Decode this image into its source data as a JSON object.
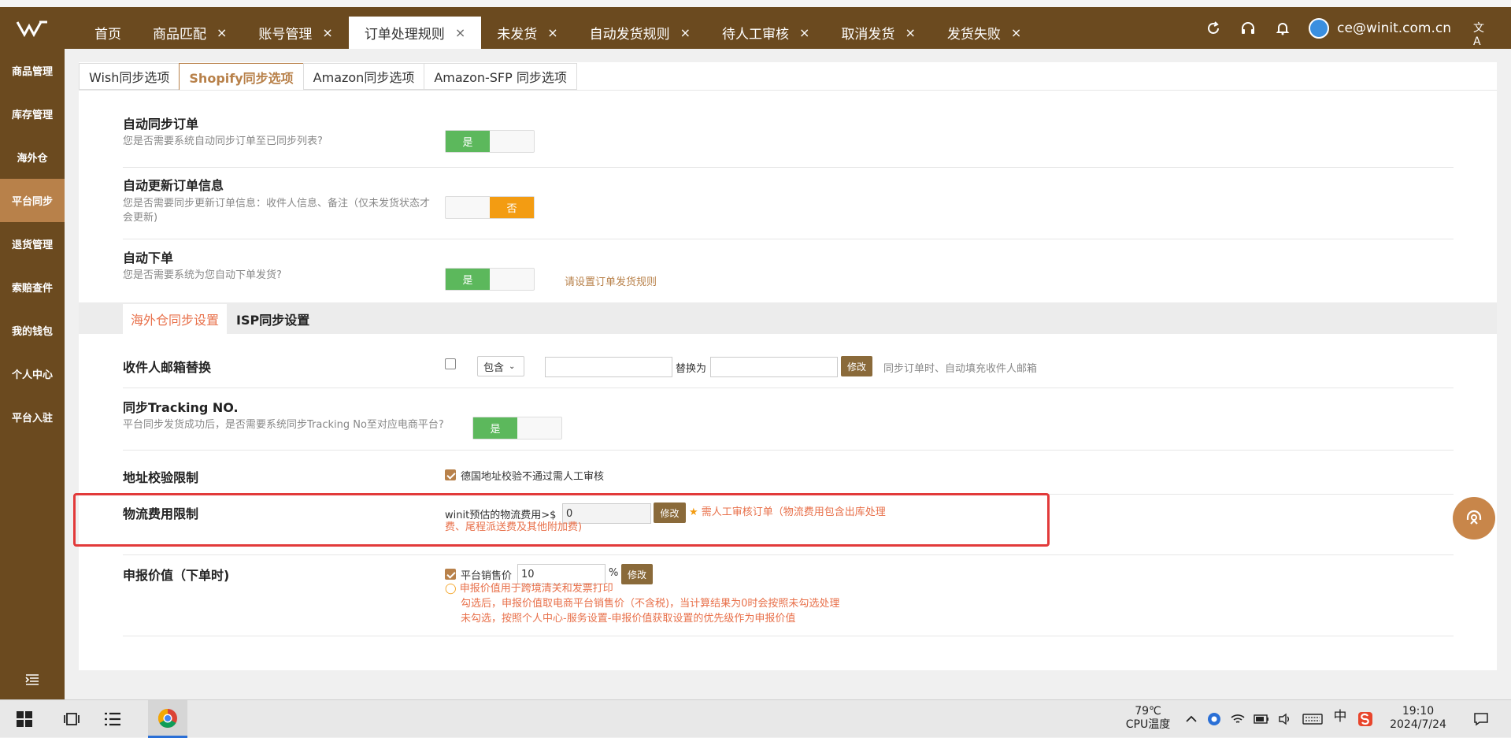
{
  "topbar": {
    "tabs": [
      {
        "label": "首页",
        "closable": false
      },
      {
        "label": "商品匹配",
        "closable": true
      },
      {
        "label": "账号管理",
        "closable": true
      },
      {
        "label": "订单处理规则",
        "closable": true,
        "active": true
      },
      {
        "label": "未发货",
        "closable": true
      },
      {
        "label": "自动发货规则",
        "closable": true
      },
      {
        "label": "待人工审核",
        "closable": true
      },
      {
        "label": "取消发货",
        "closable": true
      },
      {
        "label": "发货失败",
        "closable": true
      }
    ],
    "close_glyph": "×",
    "user_email": "ce@winit.com.cn",
    "lang_glyph": "文A"
  },
  "sidebar": {
    "items": [
      "商品管理",
      "库存管理",
      "海外仓",
      "平台同步",
      "退货管理",
      "索赔查件",
      "我的钱包",
      "个人中心",
      "平台入驻"
    ],
    "active_index": 3
  },
  "subtabs": [
    "Wish同步选项",
    "Shopify同步选项",
    "Amazon同步选项",
    "Amazon-SFP 同步选项"
  ],
  "subtabs_active": 1,
  "rows": {
    "auto_sync": {
      "title": "自动同步订单",
      "desc": "您是否需要系统自动同步订单至已同步列表?",
      "switch": "是"
    },
    "auto_update": {
      "title": "自动更新订单信息",
      "desc": "您是否需要同步更新订单信息：收件人信息、备注（仅未发货状态才会更新)",
      "switch": "否"
    },
    "auto_order": {
      "title": "自动下单",
      "desc": "您是否需要系统为您自动下单发货?",
      "switch": "是",
      "link": "请设置订单发货规则"
    }
  },
  "section_tabs": [
    "海外仓同步设置",
    "ISP同步设置"
  ],
  "settings": {
    "email_replace": {
      "title": "收件人邮箱替换",
      "select": "包含",
      "replace_label": "替换为",
      "button": "修改",
      "hint": "同步订单时、自动填充收件人邮箱"
    },
    "tracking": {
      "title": "同步Tracking NO.",
      "desc": "平台同步发货成功后，是否需要系统同步Tracking No至对应电商平台?",
      "switch": "是"
    },
    "address": {
      "title": "地址校验限制",
      "checkbox_label": "德国地址校验不通过需人工审核"
    },
    "logistics": {
      "title": "物流费用限制",
      "label": "winit预估的物流费用>$",
      "value": "0",
      "button": "修改",
      "warn_line1": "需人工审核订单（物流费用包含出库处理",
      "warn_line2": "费、尾程派送费及其他附加费)"
    },
    "declared": {
      "title": "申报价值（下单时)",
      "checkbox_label": "平台销售价",
      "value": "10",
      "unit": "%",
      "button": "修改",
      "notes": [
        "申报价值用于跨境清关和发票打印",
        "勾选后，申报价值取电商平台销售价（不含税)，当计算结果为0时会按照未勾选处理",
        "未勾选，按照个人中心-服务设置-申报价值获取设置的优先级作为申报价值"
      ]
    }
  },
  "taskbar": {
    "temp": "79℃",
    "temp_label": "CPU温度",
    "ime": "中",
    "time": "19:10",
    "date": "2024/7/24"
  },
  "colors": {
    "brand": "#6b4a1f",
    "accent": "#b8814a",
    "switch_on": "#5cb85c",
    "switch_off": "#f39c12",
    "highlight": "#e23a3a"
  }
}
